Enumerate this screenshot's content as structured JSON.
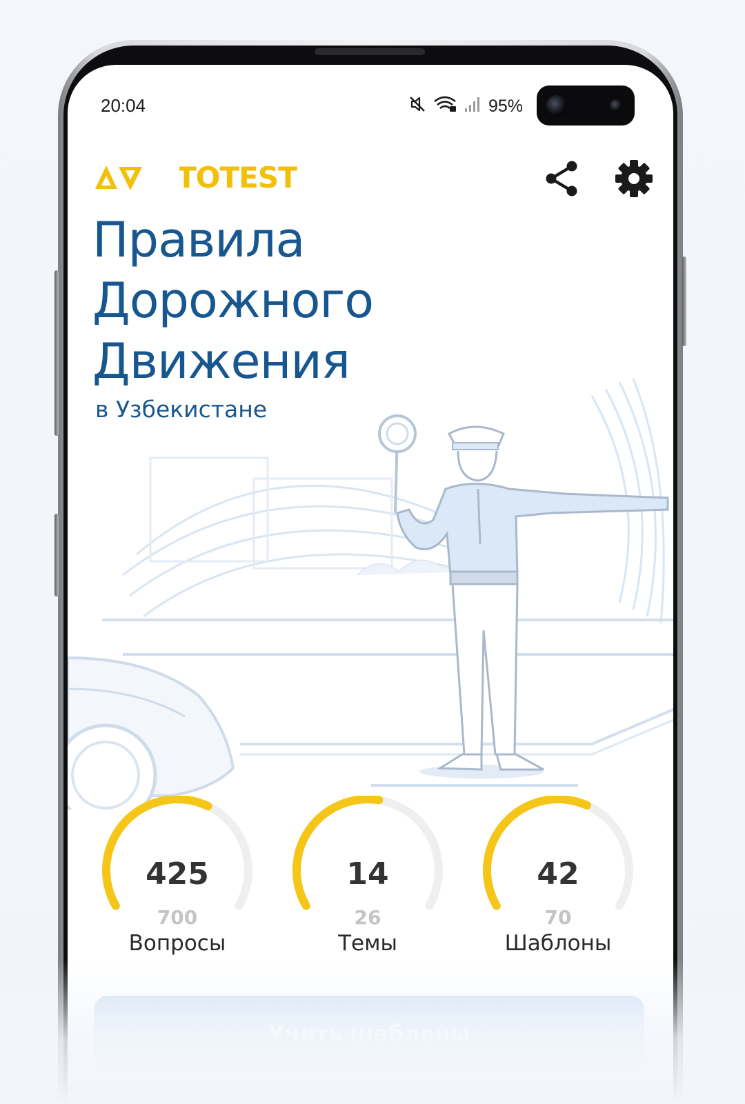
{
  "status_bar": {
    "time": "20:04",
    "battery": "95%",
    "icons": [
      "mute-icon",
      "wifi-icon",
      "signal-icon"
    ]
  },
  "header": {
    "logo": "AVTOTEST",
    "share_icon": "share-icon",
    "settings_icon": "gear-icon"
  },
  "hero": {
    "title_line1": "Правила",
    "title_line2": "Дорожного",
    "title_line3": "Движения",
    "subtitle": "в Узбекистане",
    "illustration": "traffic-police-officer-illustration"
  },
  "stats": [
    {
      "value": "425",
      "total": "700",
      "label": "Вопросы",
      "progress": 0.607
    },
    {
      "value": "14",
      "total": "26",
      "label": "Темы",
      "progress": 0.538
    },
    {
      "value": "42",
      "total": "70",
      "label": "Шаблоны",
      "progress": 0.6
    }
  ],
  "action_button": {
    "label": "Учить шаблоны"
  },
  "colors": {
    "brand_yellow": "#f2c00a",
    "title_blue": "#17568f",
    "gauge_track": "#efefef"
  }
}
